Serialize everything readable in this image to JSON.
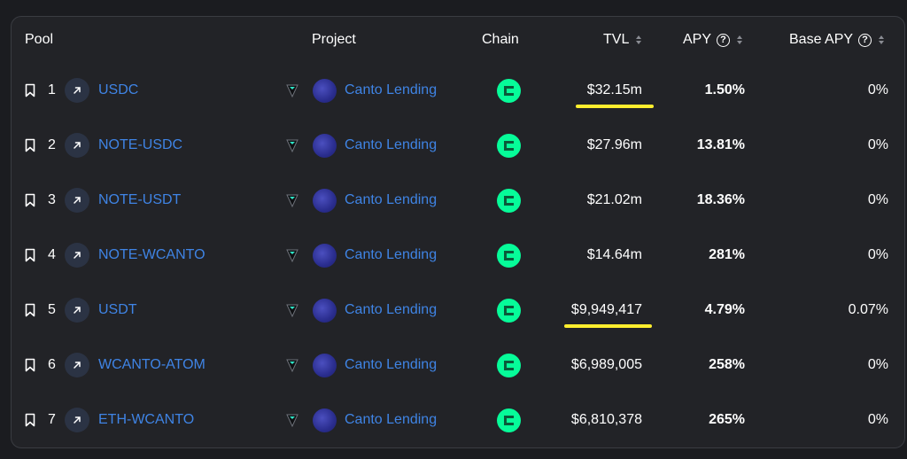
{
  "header": {
    "pool": "Pool",
    "project": "Project",
    "chain": "Chain",
    "tvl": "TVL",
    "apy": "APY",
    "base_apy": "Base APY",
    "help_glyph": "?"
  },
  "rows": [
    {
      "rank": "1",
      "pool": "USDC",
      "project": "Canto Lending",
      "tvl": "$32.15m",
      "apy": "1.50%",
      "base_apy": "0%",
      "highlighted": true
    },
    {
      "rank": "2",
      "pool": "NOTE-USDC",
      "project": "Canto Lending",
      "tvl": "$27.96m",
      "apy": "13.81%",
      "base_apy": "0%",
      "highlighted": false
    },
    {
      "rank": "3",
      "pool": "NOTE-USDT",
      "project": "Canto Lending",
      "tvl": "$21.02m",
      "apy": "18.36%",
      "base_apy": "0%",
      "highlighted": false
    },
    {
      "rank": "4",
      "pool": "NOTE-WCANTO",
      "project": "Canto Lending",
      "tvl": "$14.64m",
      "apy": "281%",
      "base_apy": "0%",
      "highlighted": false
    },
    {
      "rank": "5",
      "pool": "USDT",
      "project": "Canto Lending",
      "tvl": "$9,949,417",
      "apy": "4.79%",
      "base_apy": "0.07%",
      "highlighted": true
    },
    {
      "rank": "6",
      "pool": "WCANTO-ATOM",
      "project": "Canto Lending",
      "tvl": "$6,989,005",
      "apy": "258%",
      "base_apy": "0%",
      "highlighted": false
    },
    {
      "rank": "7",
      "pool": "ETH-WCANTO",
      "project": "Canto Lending",
      "tvl": "$6,810,378",
      "apy": "265%",
      "base_apy": "0%",
      "highlighted": false
    }
  ],
  "colors": {
    "background": "#1b1c20",
    "panel": "#222327",
    "link": "#3f84e5",
    "chain_icon": "#06fc99",
    "highlight": "#ffee2e"
  },
  "icons": {
    "bookmark": "bookmark-icon",
    "link": "external-link-arrow-icon",
    "token": "token-icon",
    "project": "canto-lending-logo",
    "chain": "canto-chain-icon",
    "help": "question-circle-icon",
    "sort": "sort-arrows-icon"
  }
}
